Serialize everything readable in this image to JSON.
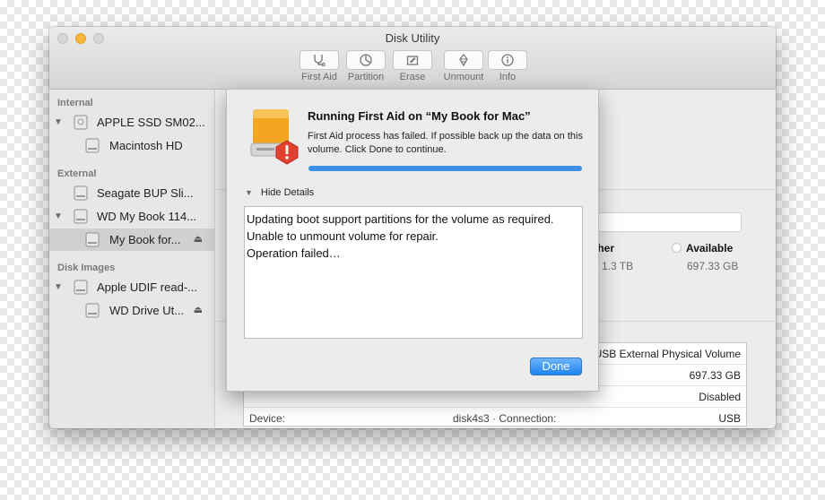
{
  "window": {
    "title": "Disk Utility"
  },
  "toolbar": {
    "items": [
      {
        "label": "First Aid",
        "icon": "stethoscope-icon"
      },
      {
        "label": "Partition",
        "icon": "pie-icon"
      },
      {
        "label": "Erase",
        "icon": "eraser-icon"
      },
      {
        "label": "Unmount",
        "icon": "unmount-icon"
      },
      {
        "label": "Info",
        "icon": "info-icon"
      }
    ]
  },
  "sidebar": {
    "sections": [
      {
        "title": "Internal"
      },
      {
        "title": "External"
      },
      {
        "title": "Disk Images"
      }
    ],
    "items": [
      {
        "label": "APPLE SSD SM02..."
      },
      {
        "label": "Macintosh HD"
      },
      {
        "label": "Seagate BUP Sli..."
      },
      {
        "label": "WD My Book 114..."
      },
      {
        "label": "My Book for...",
        "selected": true
      },
      {
        "label": "Apple UDIF read-..."
      },
      {
        "label": "WD Drive Ut..."
      }
    ]
  },
  "main": {
    "legend": [
      {
        "label": "Other",
        "value": "1.3 TB"
      },
      {
        "label": "Available",
        "value": "697.33 GB"
      }
    ],
    "info_rows": [
      {
        "value": "USB External Physical Volume"
      },
      {
        "value": "697.33 GB"
      },
      {
        "value": "Disabled"
      },
      {
        "key": "Device:",
        "mid": "disk4s3 · Connection:",
        "value": "USB"
      }
    ]
  },
  "dialog": {
    "title": "Running First Aid on “My Book for Mac”",
    "message": "First Aid process has failed. If possible back up the data on this volume. Click Done to continue.",
    "progress": 1.0,
    "details_label": "Hide Details",
    "log_lines": [
      "Updating boot support partitions for the volume as required.",
      "Unable to unmount volume for repair.",
      "Operation failed…"
    ],
    "done_label": "Done"
  },
  "colors": {
    "accent": "#3d8fe6",
    "warning": "#e2412f",
    "disk": "#f4a623"
  }
}
